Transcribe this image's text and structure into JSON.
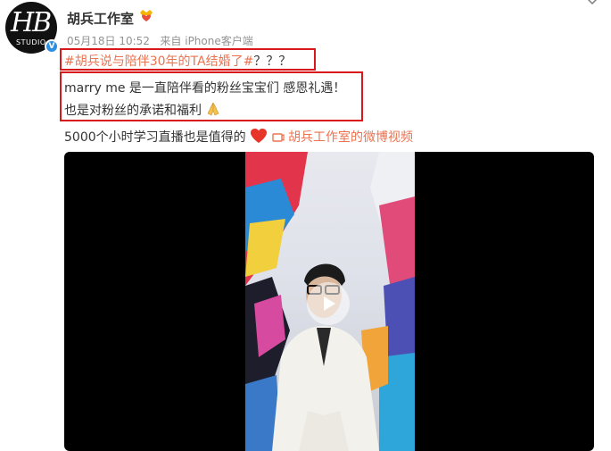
{
  "post": {
    "avatar_mark": "HB",
    "avatar_studio": "STUDIO",
    "verified_mark": "V",
    "username": "胡兵工作室",
    "date": "05月18日 10:52",
    "source": "来自 iPhone客户端",
    "topic": "#胡兵说与陪伴30年的TA结婚了#",
    "topic_suffix": "？？？",
    "line1": "marry me 是一直陪伴看的粉丝宝宝们 感恩礼遇！",
    "line2": "也是对粉丝的承诺和福利",
    "line3_text": "5000个小时学习直播也是值得的",
    "video_link": "胡兵工作室的微博视频"
  },
  "colors": {
    "link": "#eb7350",
    "highlight_border": "#d7191c",
    "meta": "#939393",
    "video_bg": "#000000"
  },
  "icons": {
    "user_badge": "gold-heart-crown-icon",
    "more": "chevron-down-icon",
    "emoji_pray": "praying-hands-icon",
    "emoji_heart": "red-heart-icon",
    "video_link": "video-link-icon",
    "play": "play-icon"
  }
}
